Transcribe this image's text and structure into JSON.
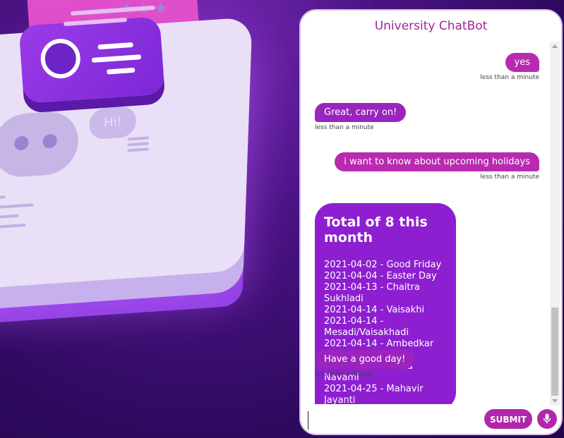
{
  "chat": {
    "title": "University ChatBot",
    "messages": [
      {
        "sender": "user",
        "text": "yes",
        "time": "less than a minute"
      },
      {
        "sender": "bot",
        "text": "Great, carry on!",
        "time": "less than a minute"
      },
      {
        "sender": "user",
        "text": "i want to know about upcoming holidays",
        "time": "less than a minute"
      },
      {
        "sender": "bot",
        "title": "Total of 8 this month",
        "holidays": [
          "2021-04-02 - Good Friday",
          "2021-04-04 - Easter Day",
          "2021-04-13 - Chaitra Sukhladi",
          "2021-04-14 - Vaisakhi",
          "2021-04-14 - Mesadi/Vaisakhadi",
          "2021-04-14 - Ambedkar Jayanti",
          "2021-04-21 - Rama Navami",
          "2021-04-25 - Mahavir Jayanti"
        ]
      },
      {
        "sender": "bot",
        "text": "Have a good day!",
        "time": "less than a minute"
      }
    ],
    "input": {
      "value": "",
      "placeholder": ""
    },
    "submit_label": "SUBMIT",
    "mic_icon": "microphone-icon"
  },
  "background": {
    "bubble_text": "Hi!",
    "stars": "★★★"
  },
  "colors": {
    "title": "#a3239c",
    "bot_bubble": "#9b24bf",
    "user_bubble": "#b82ab0",
    "highlight_bubble": "#8e1fd0",
    "submit": "#b027aa"
  }
}
